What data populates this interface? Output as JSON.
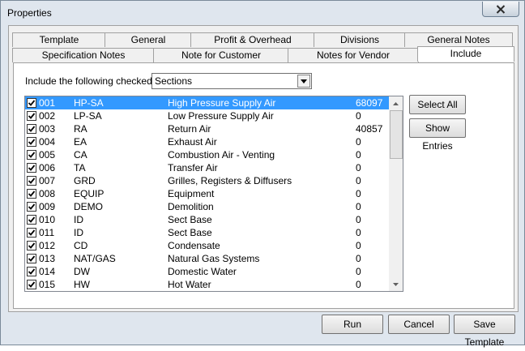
{
  "window": {
    "title": "Properties"
  },
  "tabs_row1": [
    "Template",
    "General",
    "Profit & Overhead",
    "Divisions",
    "General Notes"
  ],
  "tabs_row2": [
    "Specification Notes",
    "Note for Customer",
    "Notes for Vendor",
    "Include"
  ],
  "include": {
    "label": "Include the following checked",
    "combo_value": "Sections"
  },
  "rows": [
    {
      "num": "001",
      "code": "HP-SA",
      "desc": "High Pressure Supply Air",
      "val": "68097"
    },
    {
      "num": "002",
      "code": "LP-SA",
      "desc": "Low Pressure Supply Air",
      "val": "0"
    },
    {
      "num": "003",
      "code": "RA",
      "desc": "Return Air",
      "val": "40857"
    },
    {
      "num": "004",
      "code": "EA",
      "desc": "Exhaust Air",
      "val": "0"
    },
    {
      "num": "005",
      "code": "CA",
      "desc": "Combustion Air - Venting",
      "val": "0"
    },
    {
      "num": "006",
      "code": "TA",
      "desc": "Transfer Air",
      "val": "0"
    },
    {
      "num": "007",
      "code": "GRD",
      "desc": "Grilles, Registers & Diffusers",
      "val": "0"
    },
    {
      "num": "008",
      "code": "EQUIP",
      "desc": "Equipment",
      "val": "0"
    },
    {
      "num": "009",
      "code": "DEMO",
      "desc": "Demolition",
      "val": "0"
    },
    {
      "num": "010",
      "code": "ID",
      "desc": "Sect Base",
      "val": "0"
    },
    {
      "num": "011",
      "code": "ID",
      "desc": "Sect Base",
      "val": "0"
    },
    {
      "num": "012",
      "code": "CD",
      "desc": "Condensate",
      "val": "0"
    },
    {
      "num": "013",
      "code": "NAT/GAS",
      "desc": "Natural Gas Systems",
      "val": "0"
    },
    {
      "num": "014",
      "code": "DW",
      "desc": "Domestic Water",
      "val": "0"
    },
    {
      "num": "015",
      "code": "HW",
      "desc": "Hot Water",
      "val": "0"
    }
  ],
  "side_buttons": {
    "select_all": "Select All",
    "show_entries": "Show Entries"
  },
  "footer": {
    "run": "Run",
    "cancel": "Cancel",
    "save_template": "Save Template"
  }
}
